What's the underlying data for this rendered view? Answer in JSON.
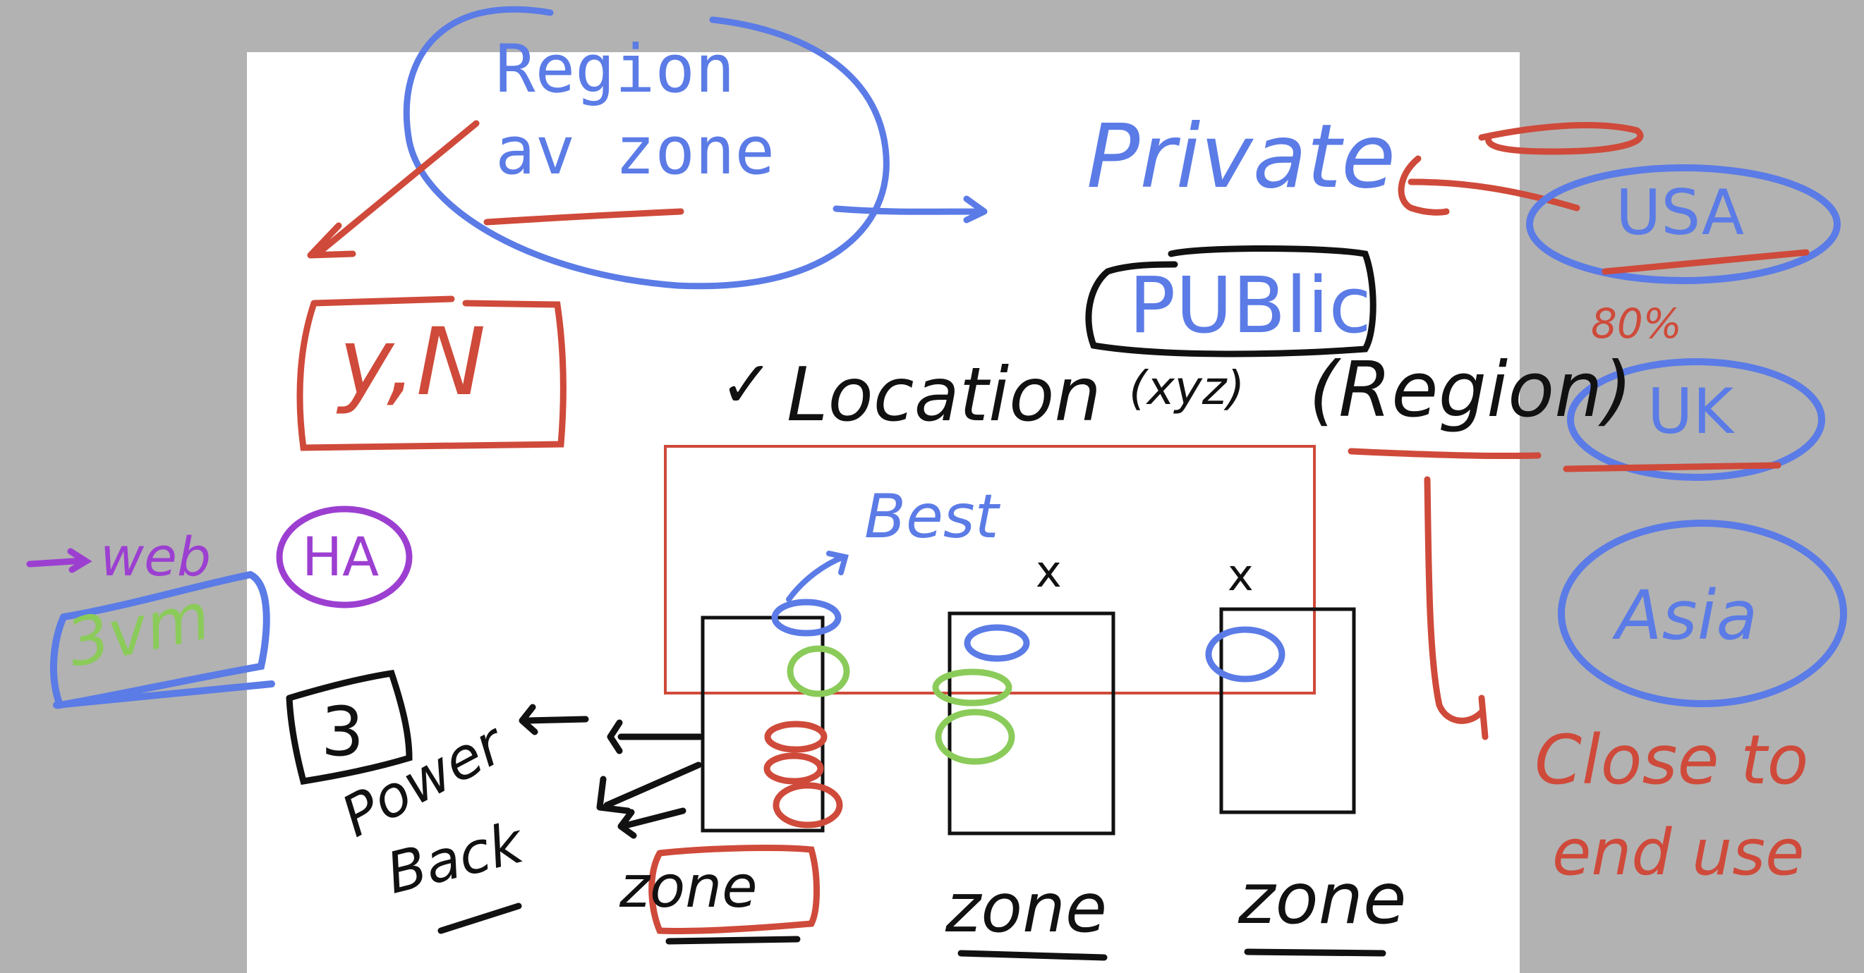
{
  "colors": {
    "blue": "#5b7be6",
    "red": "#cf4a3a",
    "black": "#111111",
    "green": "#8bcb5a",
    "purple": "#9c3fd1",
    "canvas": "#b2b2b2",
    "board": "#ffffff"
  },
  "typed_heading": {
    "line1": "Region",
    "line2": "av zone"
  },
  "labels": {
    "private": "Private",
    "public": "PUBlic",
    "location": "Location",
    "xyz": "(xyz)",
    "region": "(Region)",
    "best": "Best",
    "yn": "y,N",
    "ha": "HA",
    "web": "web",
    "vm": "3vm",
    "three": "3",
    "power": "Power",
    "back": "Back",
    "close_to": "Close to",
    "end_use": "end use",
    "usa": "USA",
    "uk": "UK",
    "asia": "Asia",
    "eighty": "80%",
    "x1": "x",
    "x2": "x",
    "checkmark": "✓"
  },
  "zones": [
    {
      "label": "zone"
    },
    {
      "label": "zone"
    },
    {
      "label": "zone"
    }
  ]
}
